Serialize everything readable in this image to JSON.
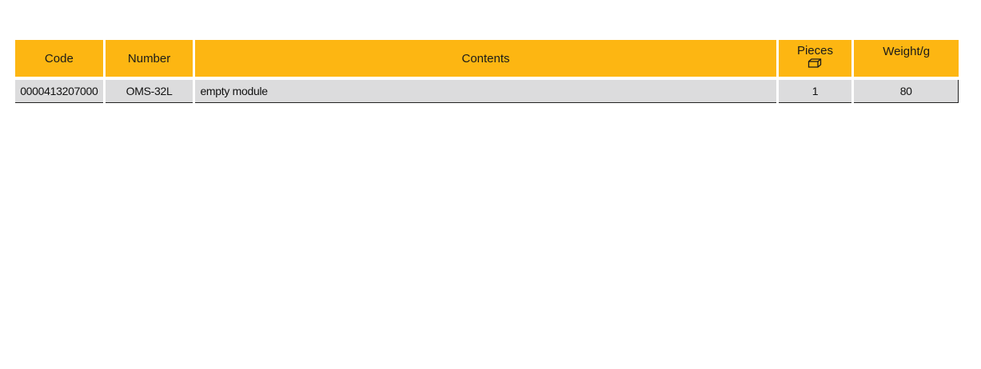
{
  "table": {
    "headers": {
      "code": "Code",
      "number": "Number",
      "contents": "Contents",
      "pieces": "Pieces",
      "pieces_icon": "box-icon",
      "weight": "Weight/g"
    },
    "rows": [
      {
        "code": "0000413207000",
        "number": "OMS-32L",
        "contents": "empty module",
        "pieces": "1",
        "weight": "80"
      }
    ]
  },
  "colors": {
    "header_background": "#fdb612",
    "row_background": "#dcdcdd"
  }
}
